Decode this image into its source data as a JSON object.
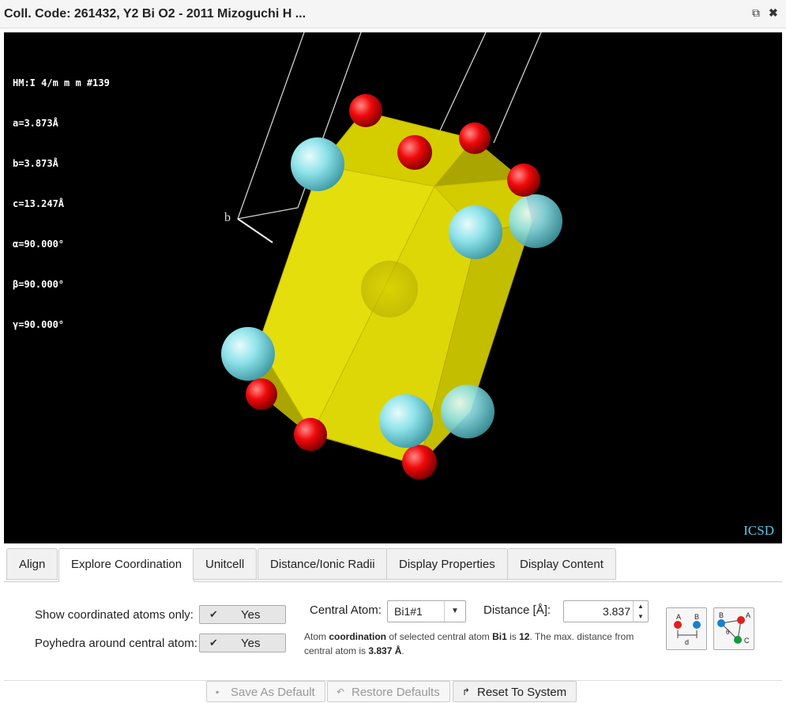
{
  "window": {
    "title": "Coll. Code: 261432, Y2 Bi O2 - 2011 Mizoguchi H ..."
  },
  "viewer": {
    "cell_params": [
      "HM:I 4/m m m #139",
      "a=3.873Å",
      "b=3.873Å",
      "c=13.247Å",
      "α=90.000°",
      "β=90.000°",
      "γ=90.000°"
    ],
    "axis_label": "b",
    "watermark": "ICSD",
    "colors": {
      "background": "#000000",
      "polyhedron": "#e6e600",
      "oxygen": "#ff0d0d",
      "yttrium": "#8ee4ea"
    }
  },
  "tabs": [
    {
      "label": "Align",
      "active": false
    },
    {
      "label": "Explore Coordination",
      "active": true
    },
    {
      "label": "Unitcell",
      "active": false
    },
    {
      "label": "Distance/Ionic Radii",
      "active": false
    },
    {
      "label": "Display Properties",
      "active": false
    },
    {
      "label": "Display Content",
      "active": false
    }
  ],
  "coordination": {
    "show_coordinated_label": "Show coordinated atoms only:",
    "show_coordinated_value": "Yes",
    "polyhedra_label": "Poyhedra around central atom:",
    "polyhedra_value": "Yes",
    "central_atom_label": "Central Atom:",
    "central_atom_value": "Bi1#1",
    "distance_label": "Distance [Å]:",
    "distance_value": "3.837",
    "info": {
      "t1": "Atom ",
      "b1": "coordination",
      "t2": " of selected central atom ",
      "b2": "Bi1",
      "t3": " is ",
      "b3": "12",
      "t4": ". The max. distance from central atom is ",
      "b4": "3.837 Å",
      "t5": "."
    },
    "icons": [
      {
        "name": "distance-tool-icon",
        "labels": [
          "A",
          "B",
          "d"
        ]
      },
      {
        "name": "angle-tool-icon",
        "labels": [
          "B",
          "A",
          "θ",
          "C"
        ]
      }
    ]
  },
  "footer": {
    "save_default": "Save As Default",
    "restore_defaults": "Restore Defaults",
    "reset_system": "Reset To System"
  }
}
